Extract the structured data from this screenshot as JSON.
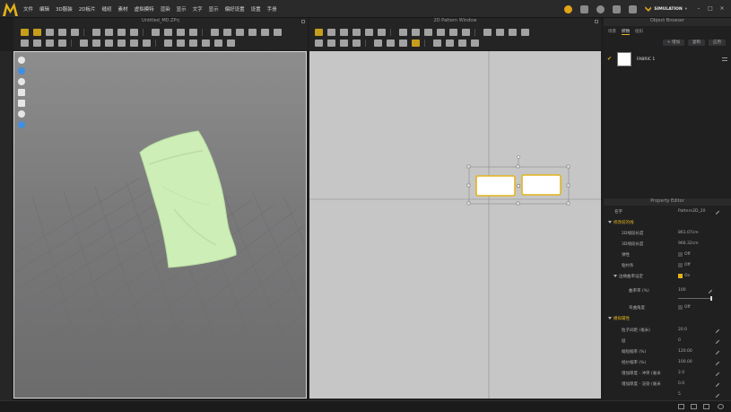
{
  "app": {
    "logo_text": "M",
    "menu": [
      "文件",
      "编辑",
      "3D服装",
      "2D板片",
      "缝纫",
      "素材",
      "虚拟模特",
      "渲染",
      "显示",
      "文字",
      "显示",
      "偏好设置",
      "设置",
      "手册"
    ],
    "simulation_label": "SIMULATION",
    "colors": {
      "accent": "#e3b41a",
      "fabric": "#cdeeb7"
    }
  },
  "view3d": {
    "title": "Untitled_MD.ZPrj"
  },
  "view2d": {
    "title": "2D Pattern Window"
  },
  "object_browser": {
    "title": "Object Browser",
    "tabs": [
      "场景",
      "织物",
      "纽扣"
    ],
    "active_tab": 1,
    "buttons": [
      "+ 增加",
      "复制",
      "应用"
    ],
    "fabric_name": "FABRIC 1"
  },
  "property_editor": {
    "title": "Property Editor",
    "name_label": "名字",
    "name_value": "Pattern2D_20",
    "section1": "修改前的线",
    "rows1": [
      {
        "label": "2D线段长度",
        "value": "861.07cm"
      },
      {
        "label": "3D线段长度",
        "value": "966.32cm"
      },
      {
        "label": "弹性",
        "value": "Off"
      },
      {
        "label": "粘衬条",
        "value": "Off"
      }
    ],
    "sub_label": "边缘曲率设定",
    "sub_value": "On",
    "sub_rows": [
      {
        "label": "曲率率 (%)",
        "value": "100"
      },
      {
        "label": "弯曲角度",
        "value": "Off"
      }
    ],
    "section2": "模拟属性",
    "rows2": [
      {
        "label": "粒子间距 (毫米)",
        "value": "20.0"
      },
      {
        "label": "层",
        "value": "0"
      },
      {
        "label": "缩短缩率 (%)",
        "value": "120.00"
      },
      {
        "label": "经纱缩率 (%)",
        "value": "100.00"
      },
      {
        "label": "增加厚度 - 冲突 (毫米",
        "value": "2.0"
      },
      {
        "label": "增加厚度 - 渲染 (毫米",
        "value": "0.0"
      },
      {
        "label": "",
        "value": "5"
      }
    ]
  }
}
